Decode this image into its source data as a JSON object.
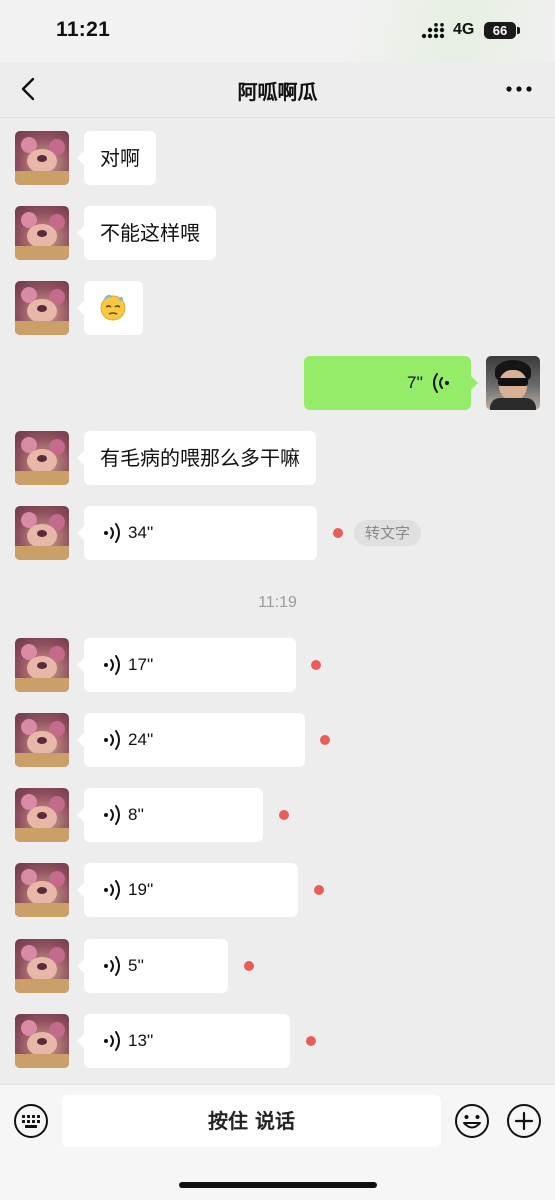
{
  "status_bar": {
    "time": "11:21",
    "network": "4G",
    "battery": "66"
  },
  "nav": {
    "title": "阿呱啊瓜"
  },
  "messages": [
    {
      "kind": "text",
      "side": "left",
      "text": "对啊"
    },
    {
      "kind": "text",
      "side": "left",
      "text": "不能这样喂"
    },
    {
      "kind": "emoji",
      "side": "left",
      "emoji": "sleepy-face-emoji"
    },
    {
      "kind": "voice",
      "side": "right",
      "duration": "7''"
    },
    {
      "kind": "text",
      "side": "left",
      "text": "有毛病的喂那么多干嘛"
    },
    {
      "kind": "voice",
      "side": "left",
      "duration": "34''",
      "unread": true,
      "action": "转文字"
    },
    {
      "kind": "time",
      "text": "11:19"
    },
    {
      "kind": "voice",
      "side": "left",
      "duration": "17''",
      "unread": true
    },
    {
      "kind": "voice",
      "side": "left",
      "duration": "24''",
      "unread": true
    },
    {
      "kind": "voice",
      "side": "left",
      "duration": "8''",
      "unread": true
    },
    {
      "kind": "voice",
      "side": "left",
      "duration": "19''",
      "unread": true
    },
    {
      "kind": "voice",
      "side": "left",
      "duration": "5''",
      "unread": true
    },
    {
      "kind": "voice",
      "side": "left",
      "duration": "13''",
      "unread": true
    }
  ],
  "bottom_bar": {
    "hold_to_talk": "按住 说话"
  },
  "colors": {
    "background": "#ededed",
    "sent_bubble": "#95ec69",
    "unread_dot": "#e75e58"
  }
}
